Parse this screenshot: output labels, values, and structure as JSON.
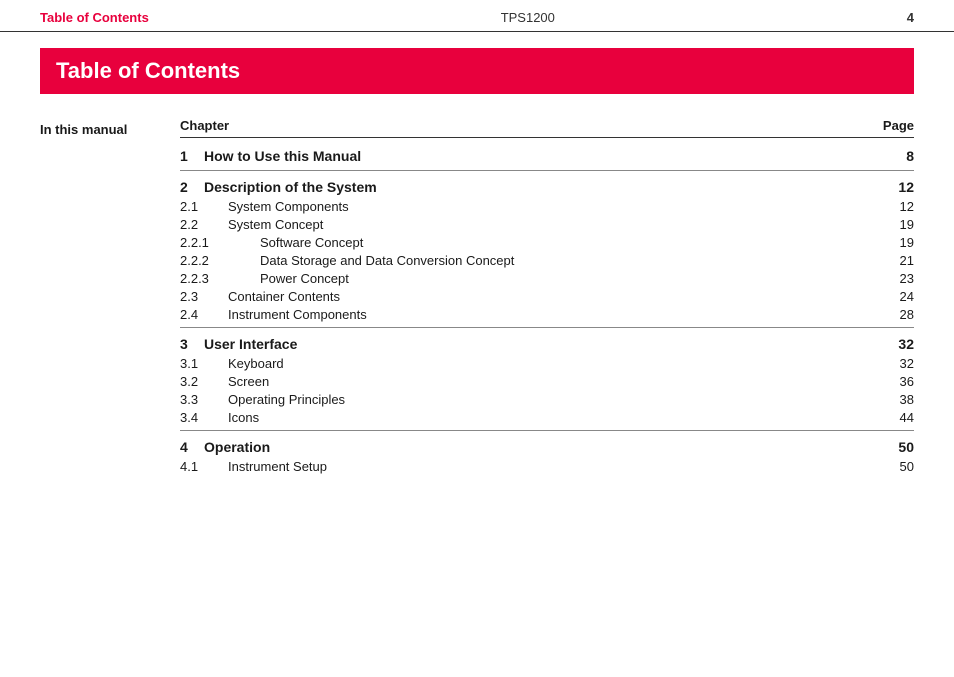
{
  "header": {
    "left": "Table of Contents",
    "center": "TPS1200",
    "right": "4"
  },
  "title": "Table of Contents",
  "sidebar": {
    "label": "In this manual"
  },
  "toc": {
    "columns": {
      "chapter": "Chapter",
      "page": "Page"
    },
    "chapters": [
      {
        "num": "1",
        "title": "How to Use this Manual",
        "page": "8",
        "subsections": []
      },
      {
        "num": "2",
        "title": "Description of the System",
        "page": "12",
        "subsections": [
          {
            "num": "2.1",
            "title": "System Components",
            "page": "12",
            "subsubsections": []
          },
          {
            "num": "2.2",
            "title": "System Concept",
            "page": "19",
            "subsubsections": [
              {
                "num": "2.2.1",
                "title": "Software Concept",
                "page": "19"
              },
              {
                "num": "2.2.2",
                "title": "Data Storage and Data Conversion Concept",
                "page": "21"
              },
              {
                "num": "2.2.3",
                "title": "Power Concept",
                "page": "23"
              }
            ]
          },
          {
            "num": "2.3",
            "title": "Container Contents",
            "page": "24",
            "subsubsections": []
          },
          {
            "num": "2.4",
            "title": "Instrument Components",
            "page": "28",
            "subsubsections": []
          }
        ]
      },
      {
        "num": "3",
        "title": "User Interface",
        "page": "32",
        "subsections": [
          {
            "num": "3.1",
            "title": "Keyboard",
            "page": "32",
            "subsubsections": []
          },
          {
            "num": "3.2",
            "title": "Screen",
            "page": "36",
            "subsubsections": []
          },
          {
            "num": "3.3",
            "title": "Operating Principles",
            "page": "38",
            "subsubsections": []
          },
          {
            "num": "3.4",
            "title": "Icons",
            "page": "44",
            "subsubsections": []
          }
        ]
      },
      {
        "num": "4",
        "title": "Operation",
        "page": "50",
        "subsections": [
          {
            "num": "4.1",
            "title": "Instrument Setup",
            "page": "50",
            "subsubsections": []
          }
        ]
      }
    ]
  }
}
